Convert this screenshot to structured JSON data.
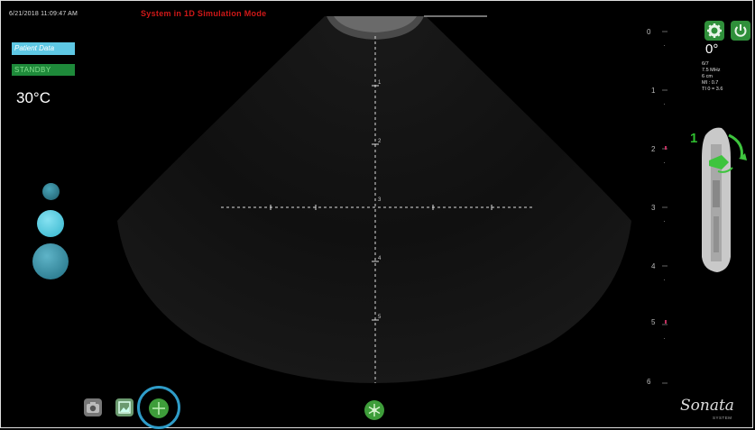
{
  "status_bar": {
    "timestamp": "6/21/2018 11:09:47 AM",
    "mode_title": "System in 1D  Simulation Mode"
  },
  "left_panel": {
    "patient_data_label": "Patient Data",
    "standby_label": "STANDBY",
    "temperature": "30°C"
  },
  "right_panel": {
    "angle": "0°",
    "params": [
      "6/7",
      "7.5 MHz",
      "6 cm",
      "MI : 0.7",
      "TI 0 = 3.6"
    ],
    "depth_scale": [
      "0",
      "1",
      "2",
      "3",
      "4",
      "5",
      "6"
    ],
    "probe_number": "1"
  },
  "image_depth_labels": [
    "1",
    "2",
    "3",
    "4",
    "5"
  ],
  "logo": {
    "text": "Sonata",
    "subtext": "SYSTEM"
  },
  "icons": {
    "settings": "gear-icon",
    "power": "power-icon",
    "camera": "camera-icon",
    "image": "image-icon",
    "crosshair": "crosshair-icon",
    "center": "snowflake-icon"
  },
  "colors": {
    "mode_title": "#d01818",
    "patient_button": "#5ec8e4",
    "standby": "#1e8a3a",
    "accent_green": "#3e9d3a",
    "highlight_ring": "#2f9cc8"
  }
}
